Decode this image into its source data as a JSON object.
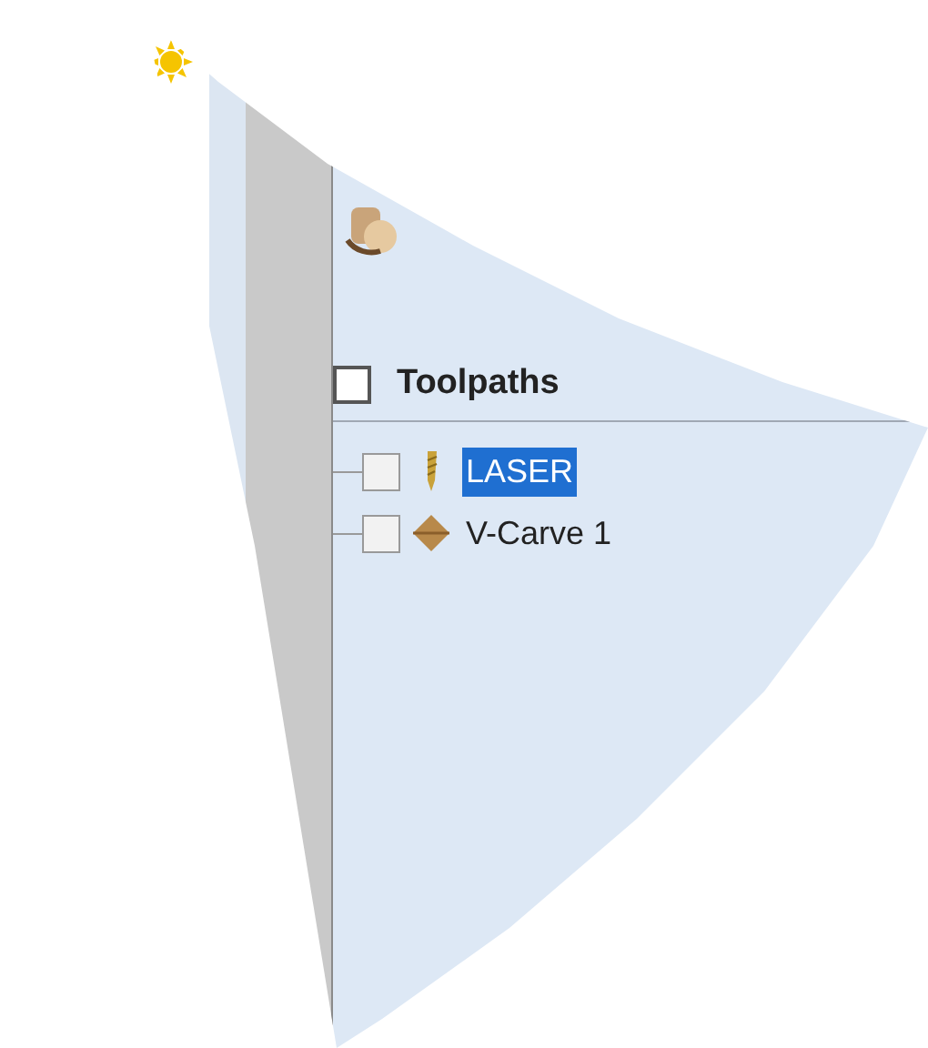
{
  "panel": {
    "title": "Toolpaths",
    "checked": false
  },
  "toolpaths": [
    {
      "name": "LASER",
      "kind": "laser",
      "checked": false,
      "selected": true
    },
    {
      "name": "V-Carve 1",
      "kind": "vcarve",
      "checked": false,
      "selected": false
    }
  ]
}
